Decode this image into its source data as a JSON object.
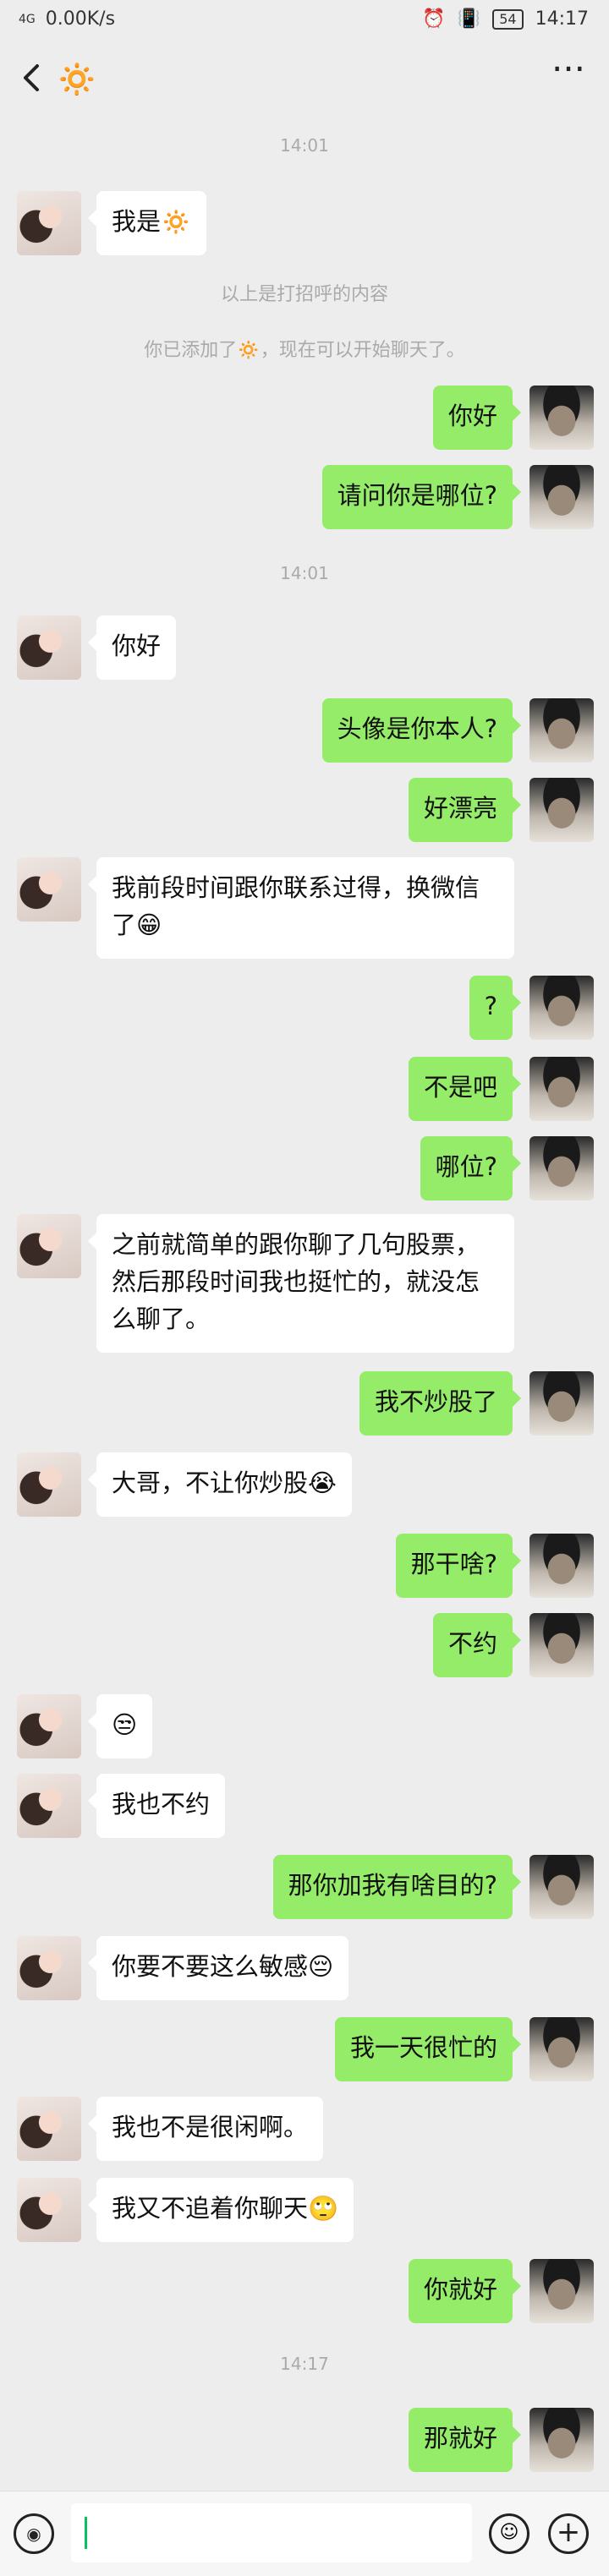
{
  "status_bar": {
    "signal": "4G",
    "speed": "0.00K/s",
    "battery": "54",
    "time": "14:17"
  },
  "title_bar": {
    "contact_name_icon": "sun-emoji",
    "sun_glyph": "🔅"
  },
  "messages": [
    {
      "type": "time",
      "text": "14:01"
    },
    {
      "type": "her",
      "text": "我是🔅"
    },
    {
      "type": "system",
      "text": "以上是打招呼的内容"
    },
    {
      "type": "system",
      "text": "你已添加了🔅，现在可以开始聊天了。"
    },
    {
      "type": "me",
      "text": "你好"
    },
    {
      "type": "me",
      "text": "请问你是哪位?"
    },
    {
      "type": "time",
      "text": "14:01"
    },
    {
      "type": "her",
      "text": "你好"
    },
    {
      "type": "me",
      "text": "头像是你本人?"
    },
    {
      "type": "me",
      "text": "好漂亮"
    },
    {
      "type": "her",
      "text": "我前段时间跟你联系过得，换微信了😁"
    },
    {
      "type": "me",
      "text": "?"
    },
    {
      "type": "me",
      "text": "不是吧"
    },
    {
      "type": "me",
      "text": "哪位?"
    },
    {
      "type": "her",
      "text": "之前就简单的跟你聊了几句股票，然后那段时间我也挺忙的，就没怎么聊了。"
    },
    {
      "type": "me",
      "text": "我不炒股了"
    },
    {
      "type": "her",
      "text": "大哥，不让你炒股😭"
    },
    {
      "type": "me",
      "text": "那干啥?"
    },
    {
      "type": "me",
      "text": "不约"
    },
    {
      "type": "her",
      "text": "😒"
    },
    {
      "type": "her",
      "text": "我也不约"
    },
    {
      "type": "me",
      "text": "那你加我有啥目的?"
    },
    {
      "type": "her",
      "text": "你要不要这么敏感😔"
    },
    {
      "type": "me",
      "text": "我一天很忙的"
    },
    {
      "type": "her",
      "text": "我也不是很闲啊。"
    },
    {
      "type": "her",
      "text": "我又不追着你聊天🙄"
    },
    {
      "type": "me",
      "text": "你就好"
    },
    {
      "type": "time",
      "text": "14:17"
    },
    {
      "type": "me",
      "text": "那就好"
    }
  ],
  "input_bar": {
    "voice_icon": "voice-icon",
    "emoji_icon": "emoji-icon",
    "plus_icon": "plus-icon",
    "value": ""
  }
}
